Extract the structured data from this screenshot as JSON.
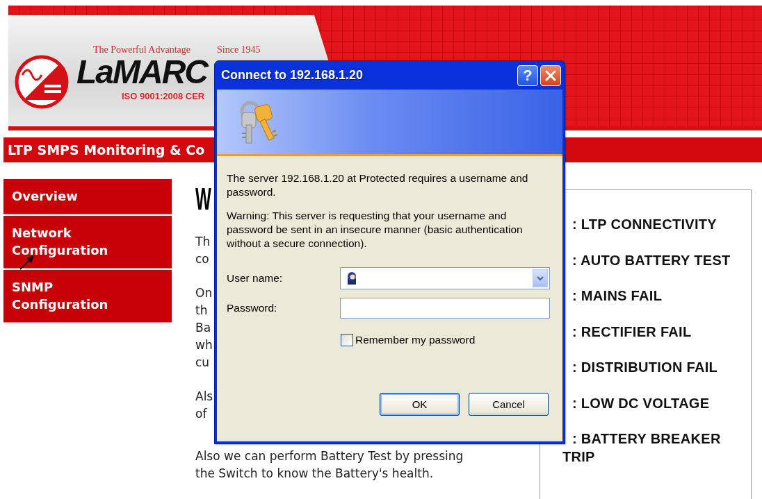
{
  "header": {
    "tagline": "The Powerful Advantage",
    "since": "Since 1945",
    "logo_text": "LaMARC",
    "certification": "ISO 9001:2008 CER"
  },
  "title_bar": {
    "text": "LTP SMPS Monitoring & Co"
  },
  "sidebar": {
    "items": [
      {
        "label": "Overview"
      },
      {
        "label": "Network Configuration"
      },
      {
        "label": "SNMP Configuration"
      }
    ]
  },
  "content": {
    "heading": "W",
    "paragraphs": [
      [
        "Th",
        "co"
      ],
      [
        "On",
        "th",
        "Ba",
        "wh",
        "cu"
      ],
      [
        "Als",
        "of"
      ],
      [
        "Also we can perform Battery Test by pressing",
        "the Switch to know the Battery's health."
      ]
    ]
  },
  "legend": {
    "items": [
      ": LTP CONNECTIVITY",
      ": AUTO BATTERY TEST",
      ": MAINS FAIL",
      ": RECTIFIER FAIL",
      ": DISTRIBUTION FAIL",
      ": LOW DC VOLTAGE",
      ": BATTERY BREAKER TRIP"
    ]
  },
  "dialog": {
    "title": "Connect to 192.168.1.20",
    "help_button": "?",
    "message": "The server 192.168.1.20 at Protected requires a username and password.",
    "warning": "Warning: This server is requesting that your username and password be sent in an insecure manner (basic authentication without a secure connection).",
    "user_label": "User name:",
    "password_label": "Password:",
    "remember": {
      "label": "Remember my password",
      "checked": false
    },
    "buttons": [
      "OK",
      "Cancel"
    ]
  }
}
